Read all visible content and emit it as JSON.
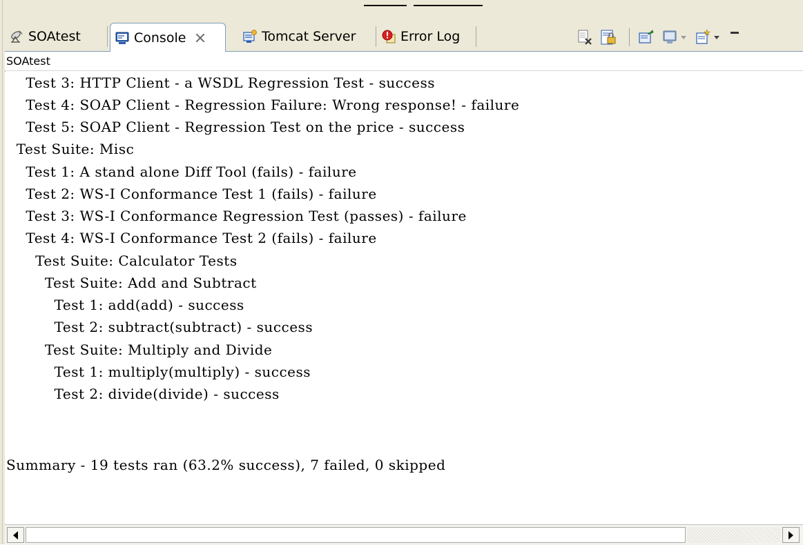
{
  "tabs": [
    {
      "label": "SOAtest",
      "icon": "satellite-dish-icon",
      "active": false
    },
    {
      "label": "Console",
      "icon": "console-monitor-icon",
      "active": true
    },
    {
      "label": "Tomcat Server",
      "icon": "server-icon",
      "active": false
    },
    {
      "label": "Error Log",
      "icon": "error-log-icon",
      "active": false
    }
  ],
  "toolbar": {
    "icons": [
      "clear-console-icon",
      "scroll-lock-icon",
      "pin-console-icon",
      "display-selected-console-icon",
      "open-console-icon",
      "minimize-icon"
    ]
  },
  "view_title": "SOAtest",
  "console_lines": [
    "    Test 3: HTTP Client - a WSDL Regression Test - success",
    "    Test 4: SOAP Client - Regression Failure: Wrong response! - failure",
    "    Test 5: SOAP Client - Regression Test on the price - success",
    "  Test Suite: Misc",
    "    Test 1: A stand alone Diff Tool (fails) - failure",
    "    Test 2: WS-I Conformance Test 1 (fails) - failure",
    "    Test 3: WS-I Conformance Regression Test (passes) - failure",
    "    Test 4: WS-I Conformance Test 2 (fails) - failure",
    "      Test Suite: Calculator Tests",
    "        Test Suite: Add and Subtract",
    "          Test 1: add(add) - success",
    "          Test 2: subtract(subtract) - success",
    "        Test Suite: Multiply and Divide",
    "          Test 1: multiply(multiply) - success",
    "          Test 2: divide(divide) - success",
    "",
    "Summary - 19 tests ran (63.2% success), 7 failed, 0 skipped"
  ],
  "colors": {
    "chrome": "#ece9d8",
    "tab_border": "#7f9db9",
    "console_bg": "#ffffff",
    "text": "#000000"
  }
}
